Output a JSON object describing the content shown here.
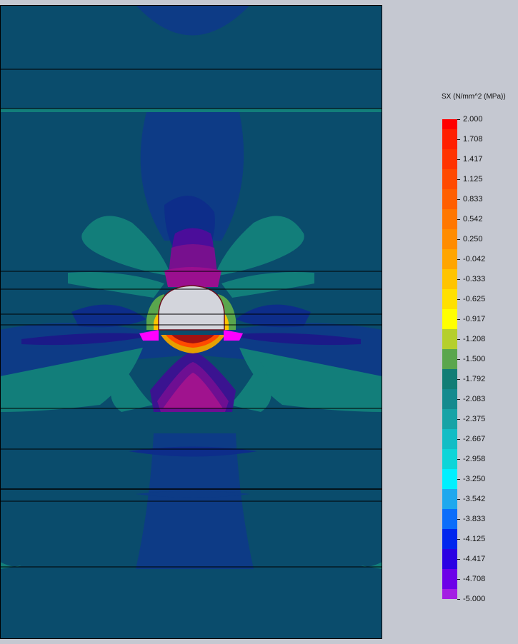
{
  "legend": {
    "title": "SX (N/mm^2 (MPa))",
    "ticks": [
      "2.000",
      "1.708",
      "1.417",
      "1.125",
      "0.833",
      "0.542",
      "0.250",
      "-0.042",
      "-0.333",
      "-0.625",
      "-0.917",
      "-1.208",
      "-1.500",
      "-1.792",
      "-2.083",
      "-2.375",
      "-2.667",
      "-2.958",
      "-3.250",
      "-3.542",
      "-3.833",
      "-4.125",
      "-4.417",
      "-4.708",
      "-5.000"
    ],
    "colors": [
      "#ff0000",
      "#ff1f00",
      "#ff3300",
      "#ff4a00",
      "#ff5f00",
      "#ff7700",
      "#ff8c00",
      "#ffa500",
      "#ffc400",
      "#ffe000",
      "#ffff00",
      "#b5cf2c",
      "#5aa64d",
      "#117d75",
      "#138a8e",
      "#16a3a6",
      "#12bdc5",
      "#0dd5d8",
      "#00f0ff",
      "#1fa8ee",
      "#0b6dfa",
      "#0026ee",
      "#2a00e3",
      "#6d00e8",
      "#a41fe3",
      "#ff00ff"
    ],
    "ramp_order": "top-to-bottom"
  },
  "model": {
    "background_color": "#0a4c6c",
    "opening_color": "#d3d5dc"
  }
}
